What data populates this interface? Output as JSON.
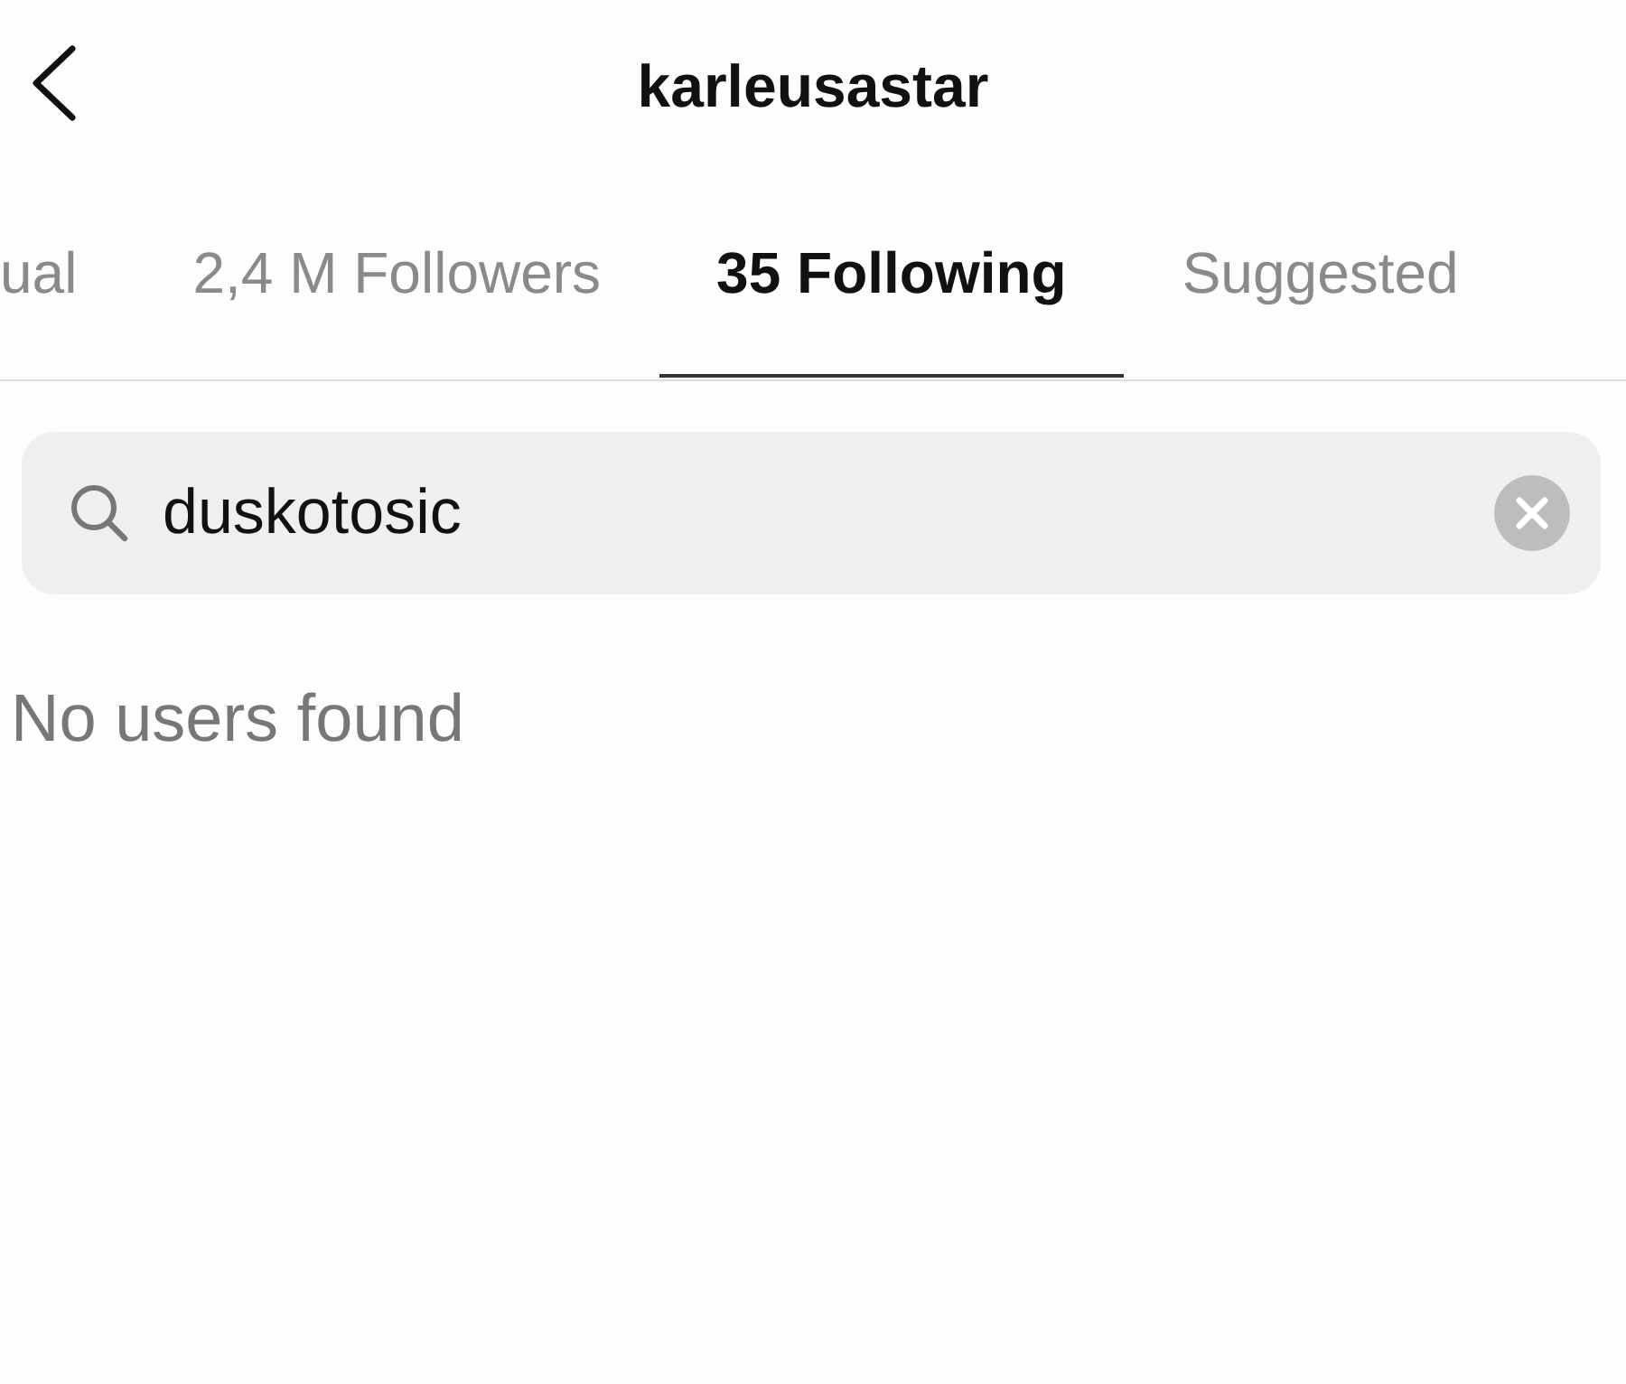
{
  "header": {
    "title": "karleusastar"
  },
  "tabs": [
    {
      "label": "ual",
      "selected": false
    },
    {
      "label": "2,4 M Followers",
      "selected": false
    },
    {
      "label": "35 Following",
      "selected": true
    },
    {
      "label": "Suggested",
      "selected": false
    }
  ],
  "search": {
    "value": "duskotosic"
  },
  "empty_message": "No users found"
}
